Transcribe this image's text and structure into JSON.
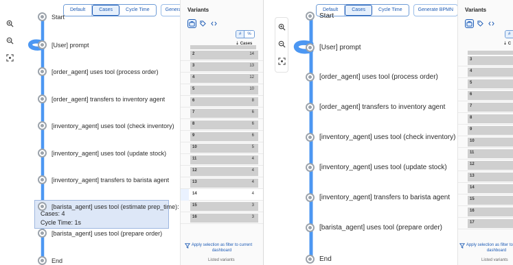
{
  "view_modes": [
    "Default",
    "Cases",
    "Cycle Time"
  ],
  "selected_view_mode": "Cases",
  "generate_bpmn_label": "Generate BPMN",
  "left_map": {
    "nodes": [
      "Start",
      "[User] prompt",
      "[order_agent] uses tool (process order)",
      "[order_agent] transfers to inventory agent",
      "[inventory_agent] uses tool (check inventory)",
      "[inventory_agent] uses tool (update stock)",
      "[inventory_agent] transfers to barista agent",
      "[barista_agent] uses tool (estimate prep_time):",
      "[barista_agent] uses tool (prepare order)",
      "End"
    ],
    "tooltip": {
      "title": "[barista_agent] uses tool (estimate prep_time):",
      "cases": "Cases: 4",
      "cycle_time": "Cycle Time: 1s"
    }
  },
  "right_map": {
    "nodes": [
      "Start",
      "[User] prompt",
      "[order_agent] uses tool (process order)",
      "[order_agent] transfers to inventory agent",
      "[inventory_agent] uses tool (check inventory)",
      "[inventory_agent] uses tool (update stock)",
      "[inventory_agent] transfers to barista agent",
      "[barista_agent] uses tool (prepare order)",
      "End"
    ]
  },
  "variants_panel": {
    "title": "Variants",
    "toggle": [
      "#",
      "%"
    ],
    "column_header": "Cases",
    "apply_label": "Apply selection as filter to current dashboard",
    "listed_label": "Listed variants",
    "left_rows": [
      {
        "id": "2",
        "cases": "14"
      },
      {
        "id": "3",
        "cases": "13"
      },
      {
        "id": "4",
        "cases": "12"
      },
      {
        "id": "5",
        "cases": "10"
      },
      {
        "id": "6",
        "cases": "8"
      },
      {
        "id": "7",
        "cases": "6"
      },
      {
        "id": "8",
        "cases": "6"
      },
      {
        "id": "9",
        "cases": "6"
      },
      {
        "id": "10",
        "cases": "5"
      },
      {
        "id": "11",
        "cases": "4"
      },
      {
        "id": "12",
        "cases": "4"
      },
      {
        "id": "13",
        "cases": "4"
      },
      {
        "id": "14",
        "cases": "4"
      },
      {
        "id": "15",
        "cases": "3"
      },
      {
        "id": "16",
        "cases": "3"
      }
    ],
    "left_selected_row": "14",
    "right_rows": [
      {
        "id": "3",
        "cases": ""
      },
      {
        "id": "4",
        "cases": ""
      },
      {
        "id": "5",
        "cases": ""
      },
      {
        "id": "6",
        "cases": ""
      },
      {
        "id": "7",
        "cases": ""
      },
      {
        "id": "8",
        "cases": ""
      },
      {
        "id": "9",
        "cases": ""
      },
      {
        "id": "10",
        "cases": ""
      },
      {
        "id": "11",
        "cases": ""
      },
      {
        "id": "12",
        "cases": ""
      },
      {
        "id": "13",
        "cases": ""
      },
      {
        "id": "14",
        "cases": ""
      },
      {
        "id": "15",
        "cases": ""
      },
      {
        "id": "16",
        "cases": ""
      },
      {
        "id": "17",
        "cases": ""
      }
    ]
  },
  "colors": {
    "flow": "#4c97f2",
    "accent": "#1d5bb5",
    "node_ring": "#9ca3ab",
    "bar": "#cfcfcf",
    "tooltip_bg": "#dde7f7"
  }
}
